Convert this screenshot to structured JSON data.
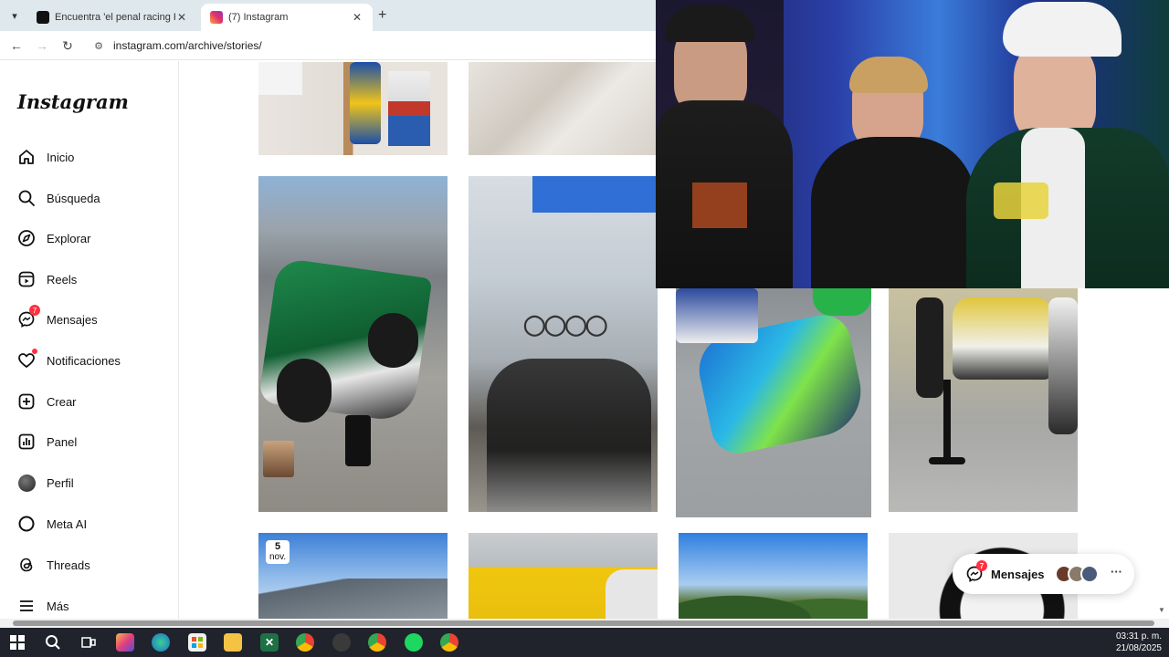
{
  "browser": {
    "tabs": [
      {
        "title": "Encuentra 'el penal racing Peña",
        "active": false
      },
      {
        "title": "(7) Instagram",
        "active": true
      }
    ],
    "address": "instagram.com/archive/stories/"
  },
  "sidebar": {
    "logo": "Instagram",
    "items": [
      {
        "label": "Inicio",
        "icon": "home-icon"
      },
      {
        "label": "Búsqueda",
        "icon": "search-icon"
      },
      {
        "label": "Explorar",
        "icon": "compass-icon"
      },
      {
        "label": "Reels",
        "icon": "reels-icon"
      },
      {
        "label": "Mensajes",
        "icon": "messenger-icon",
        "badge": "7"
      },
      {
        "label": "Notificaciones",
        "icon": "heart-icon",
        "dot": true
      },
      {
        "label": "Crear",
        "icon": "plus-square-icon"
      },
      {
        "label": "Panel",
        "icon": "chart-icon"
      },
      {
        "label": "Perfil",
        "icon": "avatar-icon"
      },
      {
        "label": "Meta AI",
        "icon": "meta-ai-icon"
      },
      {
        "label": "Threads",
        "icon": "threads-icon"
      },
      {
        "label": "Más",
        "icon": "menu-icon"
      }
    ]
  },
  "grid": {
    "date_badge": {
      "day": "5",
      "month": "nov."
    }
  },
  "messages_pill": {
    "label": "Mensajes",
    "badge": "7",
    "more": "···"
  },
  "taskbar": {
    "time": "03:31 p. m.",
    "date": "21/08/2025"
  },
  "colors": {
    "accent_red": "#ff3040",
    "taskbar": "#20232b",
    "tabbar": "#dfe8ec"
  }
}
